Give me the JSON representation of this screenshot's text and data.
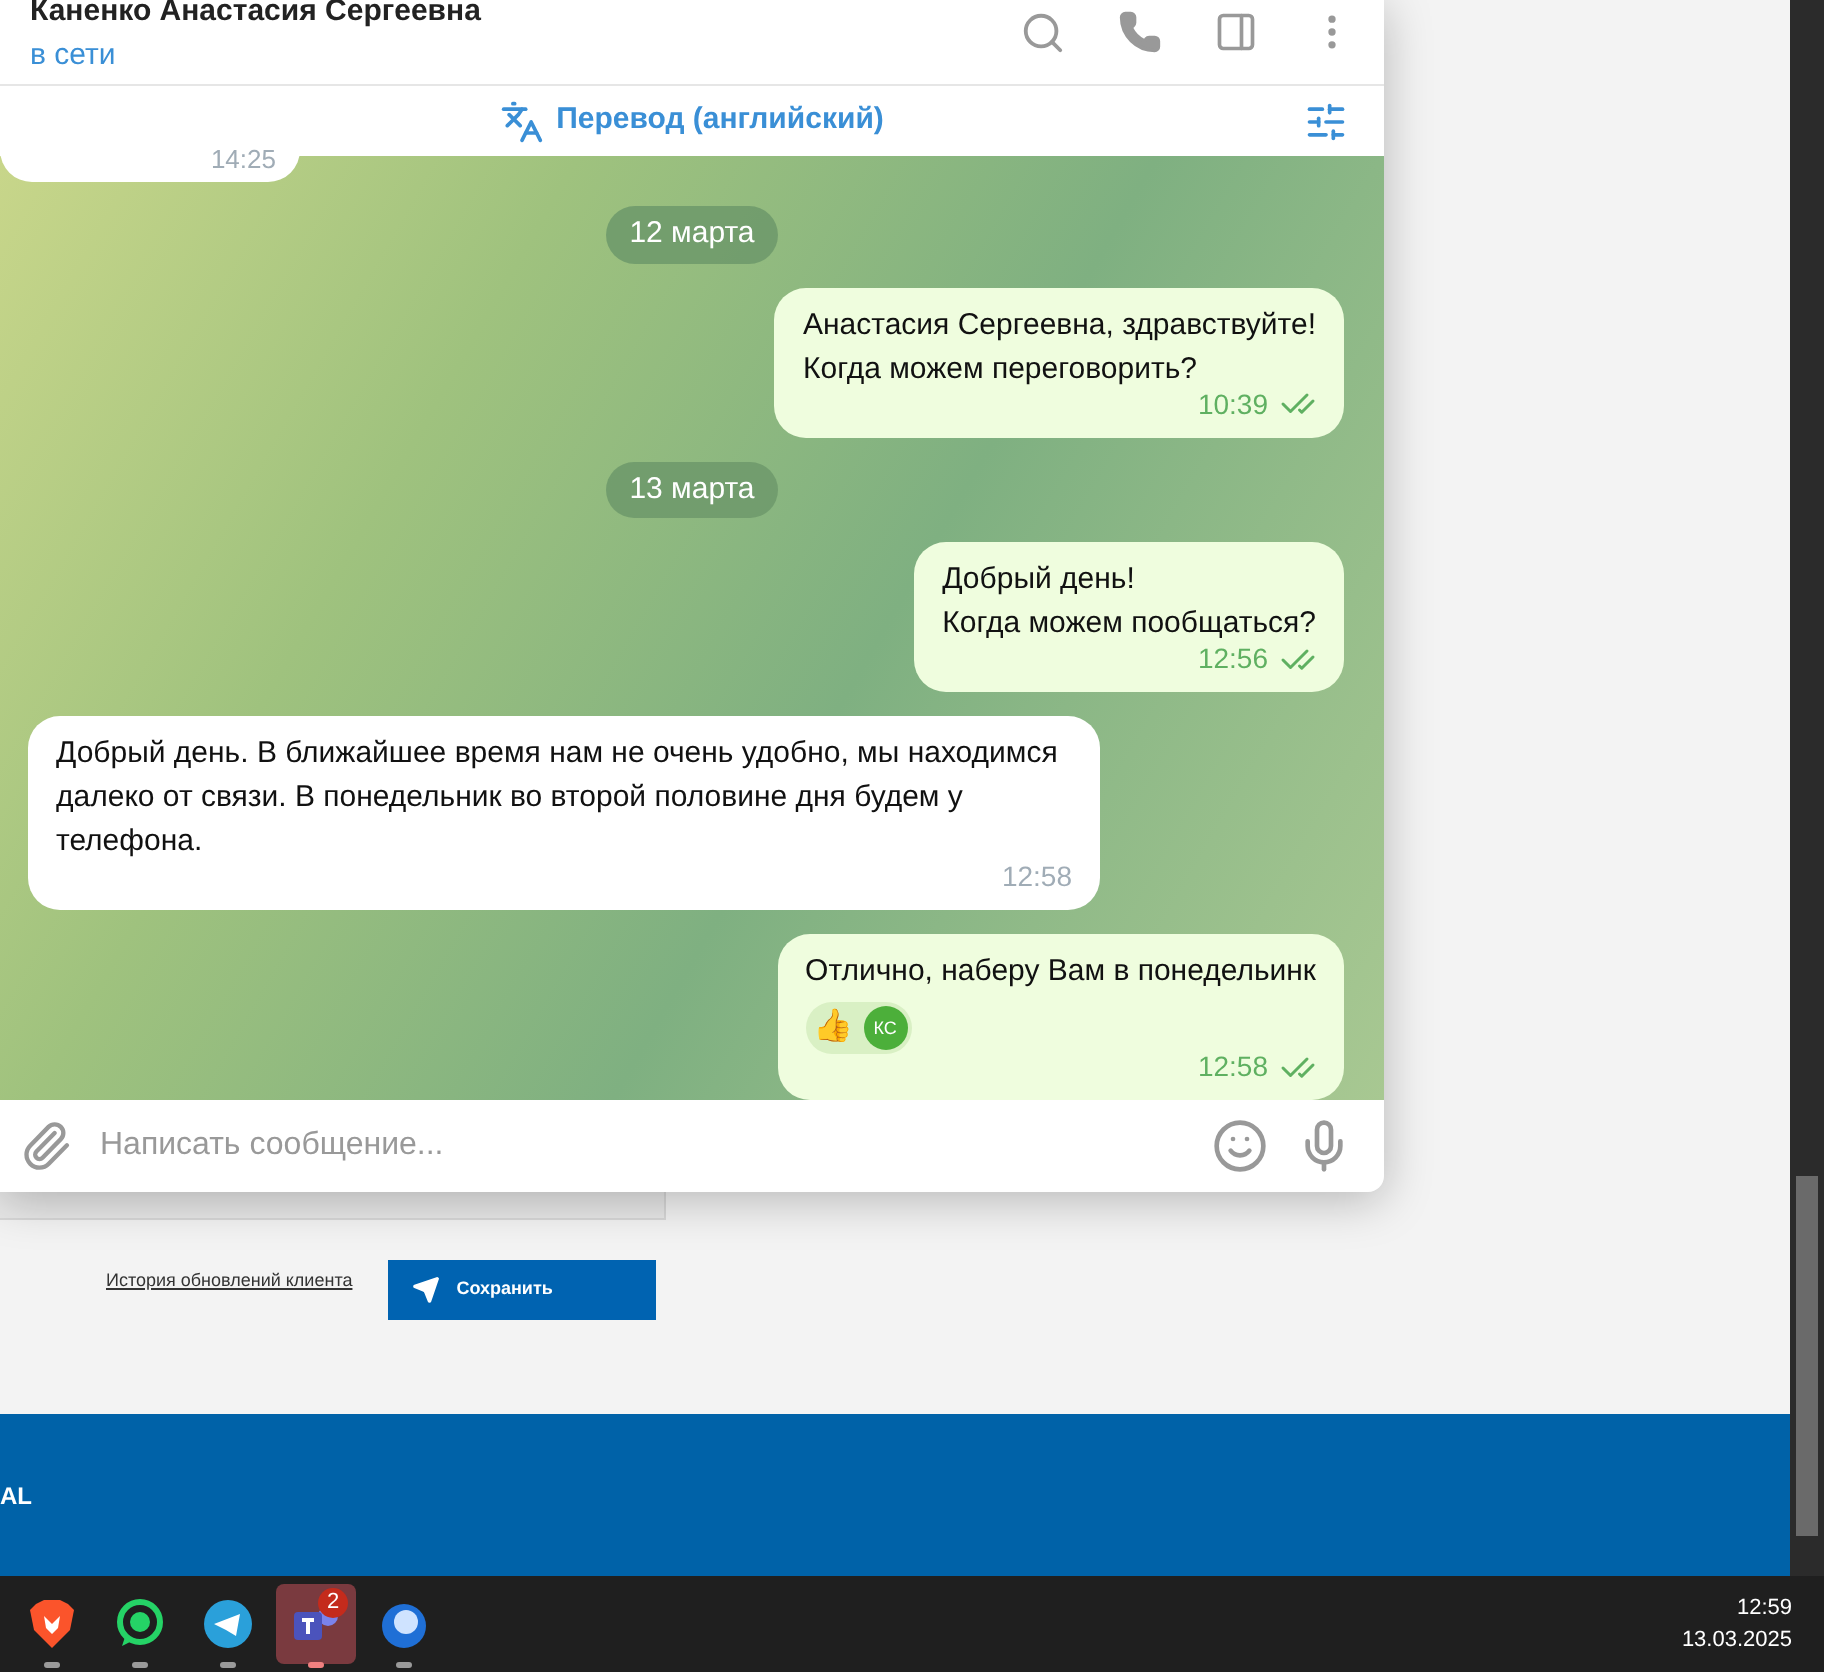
{
  "chat": {
    "title": "Каненко Анастасия Сергеевна",
    "status": "в сети",
    "translate": "Перевод (английский)",
    "messages": [
      {
        "kind": "partial",
        "out": false,
        "time": "14:25"
      },
      {
        "kind": "date",
        "text": "12 марта"
      },
      {
        "kind": "message",
        "out": true,
        "text": "Анастасия Сергеевна, здравствуйте!\nКогда можем переговорить?",
        "time": "10:39",
        "read": true
      },
      {
        "kind": "date",
        "text": "13 марта"
      },
      {
        "kind": "message",
        "out": true,
        "text": "Добрый день!\nКогда можем пообщаться?",
        "time": "12:56",
        "read": true
      },
      {
        "kind": "message",
        "out": false,
        "text": "Добрый день. В ближайшее время нам не очень удобно, мы находимся далеко от связи. В понедельник во второй половине дня будем у телефона.",
        "time": "12:58"
      },
      {
        "kind": "message",
        "out": true,
        "text": "Отлично, наберу Вам в понедельинк",
        "time": "12:58",
        "read": true,
        "reaction": {
          "emoji": "👍",
          "avatar": "КС"
        }
      }
    ],
    "input_placeholder": "Написать сообщение..."
  },
  "page": {
    "link": "История обновлений клиента",
    "save_button": "Сохранить",
    "banner_text": "AL"
  },
  "taskbar": {
    "apps": [
      {
        "kind": "brave",
        "selected": false
      },
      {
        "kind": "whatsapp",
        "selected": false
      },
      {
        "kind": "telegram",
        "selected": false
      },
      {
        "kind": "teams",
        "selected": true,
        "badge": "2"
      },
      {
        "kind": "thunderbird",
        "selected": false
      }
    ],
    "time": "12:59",
    "date": "13.03.2025"
  }
}
